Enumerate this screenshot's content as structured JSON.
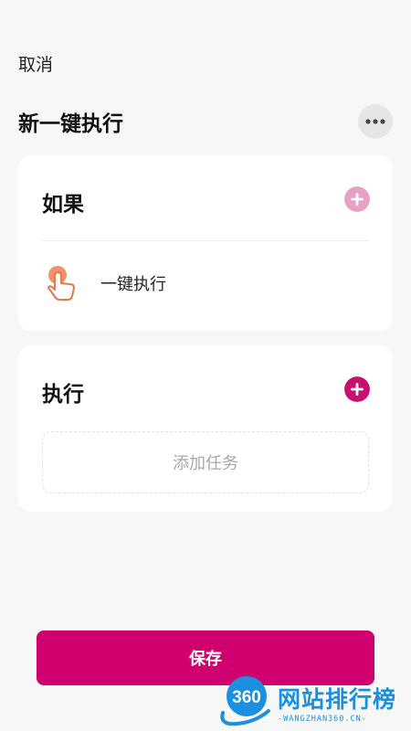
{
  "header": {
    "cancel_label": "取消",
    "title": "新一键执行",
    "more_icon": "more-horizontal-icon"
  },
  "if_card": {
    "heading": "如果",
    "add_icon": "plus-circle-icon",
    "add_color": "#e8a0c6",
    "trigger": {
      "icon": "tap-hand-icon",
      "label": "一键执行"
    }
  },
  "do_card": {
    "heading": "执行",
    "add_icon": "plus-circle-icon",
    "add_color": "#c8106e",
    "placeholder": "添加任务"
  },
  "footer": {
    "save_label": "保存",
    "accent": "#d0006f"
  },
  "watermark": {
    "logo_text": "360",
    "title": "网站排行榜",
    "subtitle": "-WANGZHAN360.CN-"
  }
}
